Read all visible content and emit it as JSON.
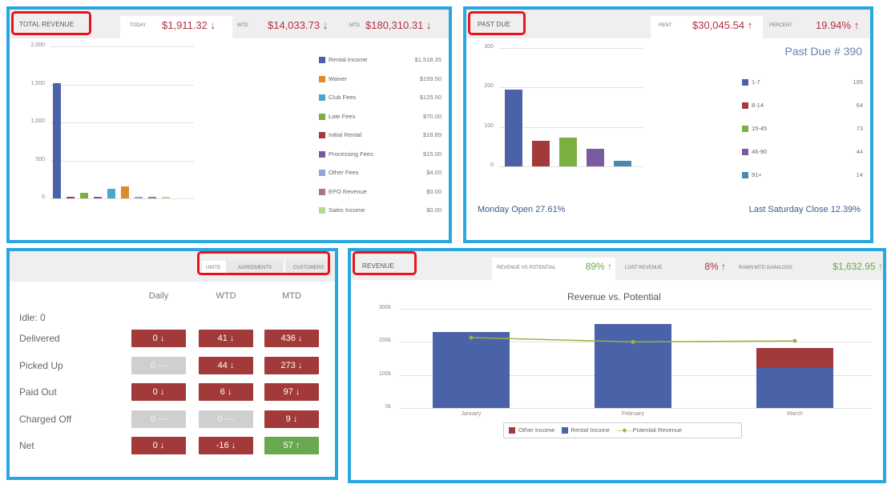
{
  "colors": {
    "panel_border": "#29a8e0",
    "highlight_box": "#e8141c",
    "negative": "#b03040",
    "positive": "#6aa84f",
    "series_rental": "#4a62a8",
    "series_other": "#a33a3a",
    "series_potential": "#9ab43c"
  },
  "total_revenue": {
    "title": "Total Revenue",
    "today_label": "Today",
    "today_value": "$1,911.32",
    "wtd_label": "WTD",
    "wtd_value": "$14,033.73",
    "mtd_label": "MTD",
    "mtd_value": "$180,310.31",
    "y_ticks": [
      "2,000",
      "1,500",
      "1,000",
      "500",
      "0"
    ],
    "legend": [
      {
        "name": "Rental Income",
        "value": "$1,518.35",
        "color": "#4a62a8"
      },
      {
        "name": "Waiver",
        "value": "$159.50",
        "color": "#e08a2c"
      },
      {
        "name": "Club Fees",
        "value": "$125.50",
        "color": "#4aa8c8"
      },
      {
        "name": "Late Fees",
        "value": "$70.00",
        "color": "#7ab040"
      },
      {
        "name": "Initial Rental",
        "value": "$18.89",
        "color": "#a33a3a"
      },
      {
        "name": "Processing Fees",
        "value": "$15.00",
        "color": "#7a5aa0"
      },
      {
        "name": "Other Fees",
        "value": "$4.00",
        "color": "#90a8d0"
      },
      {
        "name": "EPO Revenue",
        "value": "$0.00",
        "color": "#a87a7a"
      },
      {
        "name": "Sales Income",
        "value": "$0.00",
        "color": "#b8d890"
      }
    ],
    "chart_data": {
      "type": "bar",
      "ylim": [
        0,
        2000
      ],
      "values": [
        1518.35,
        18.89,
        70.0,
        15.0,
        125.5,
        159.5,
        4.0,
        4.0,
        0
      ],
      "colors": [
        "#4a62a8",
        "#a33a3a",
        "#7ab040",
        "#7a5aa0",
        "#4aa8c8",
        "#e08a2c",
        "#90a8d0",
        "#a87a7a",
        "#b8d890"
      ]
    }
  },
  "past_due": {
    "title": "Past Due",
    "rent_label": "Rent",
    "rent_value": "$30,045.54",
    "percent_label": "Percent",
    "percent_value": "19.94%",
    "count_title": "Past Due # 390",
    "y_ticks": [
      "300",
      "200",
      "100",
      "0"
    ],
    "legend": [
      {
        "name": "1-7",
        "value": "195",
        "color": "#4a62a8"
      },
      {
        "name": "8-14",
        "value": "64",
        "color": "#a33a3a"
      },
      {
        "name": "15-45",
        "value": "73",
        "color": "#7ab040"
      },
      {
        "name": "46-90",
        "value": "44",
        "color": "#7a5aa0"
      },
      {
        "name": "91+",
        "value": "14",
        "color": "#4a8ab0"
      }
    ],
    "chart_data": {
      "type": "bar",
      "categories": [
        "1-7",
        "8-14",
        "15-45",
        "46-90",
        "91+"
      ],
      "values": [
        195,
        64,
        73,
        44,
        14
      ],
      "ylim": [
        0,
        300
      ]
    },
    "footer_left": "Monday Open 27.61%",
    "footer_right": "Last Saturday Close 12.39%"
  },
  "units": {
    "tabs": [
      "Units",
      "Agreements",
      "Customers"
    ],
    "columns": [
      "Daily",
      "WTD",
      "MTD"
    ],
    "idle": "Idle: 0",
    "rows": [
      {
        "label": "Delivered",
        "cells": [
          {
            "v": "0",
            "dir": "down",
            "kind": "red"
          },
          {
            "v": "41",
            "dir": "down",
            "kind": "red"
          },
          {
            "v": "436",
            "dir": "down",
            "kind": "red"
          }
        ]
      },
      {
        "label": "Picked Up",
        "cells": [
          {
            "v": "0",
            "dir": "flat",
            "kind": "gray"
          },
          {
            "v": "44",
            "dir": "down",
            "kind": "red"
          },
          {
            "v": "273",
            "dir": "down",
            "kind": "red"
          }
        ]
      },
      {
        "label": "Paid Out",
        "cells": [
          {
            "v": "0",
            "dir": "down",
            "kind": "red"
          },
          {
            "v": "6",
            "dir": "down",
            "kind": "red"
          },
          {
            "v": "97",
            "dir": "down",
            "kind": "red"
          }
        ]
      },
      {
        "label": "Charged Off",
        "cells": [
          {
            "v": "0",
            "dir": "flat",
            "kind": "gray"
          },
          {
            "v": "0",
            "dir": "flat",
            "kind": "gray"
          },
          {
            "v": "9",
            "dir": "down",
            "kind": "red"
          }
        ]
      },
      {
        "label": "Net",
        "cells": [
          {
            "v": "0",
            "dir": "down",
            "kind": "red"
          },
          {
            "v": "-16",
            "dir": "down",
            "kind": "red"
          },
          {
            "v": "57",
            "dir": "up",
            "kind": "green"
          }
        ]
      }
    ]
  },
  "revenue": {
    "title": "Revenue",
    "tabs": [
      {
        "label": "Revenue vs Potential",
        "value": "89%",
        "dir": "up",
        "color": "#6aa84f"
      },
      {
        "label": "Lost Revenue",
        "value": "8%",
        "dir": "up",
        "color": "#b03040"
      },
      {
        "label": "Rawn MTD Gain/Loss",
        "value": "$1,632.95",
        "dir": "up",
        "color": "#6aa84f"
      }
    ],
    "chart_title": "Revenue vs. Potential",
    "y_ticks": [
      "300k",
      "200k",
      "100k",
      "0k"
    ],
    "legend": [
      "Other Income",
      "Rental Income",
      "Potential Revenue"
    ],
    "chart_data": {
      "type": "bar",
      "categories": [
        "January",
        "February",
        "March"
      ],
      "ylim": [
        0,
        300000
      ],
      "series": [
        {
          "name": "Rental Income",
          "values": [
            230000,
            255000,
            120000
          ]
        },
        {
          "name": "Other Income",
          "values": [
            0,
            0,
            62000
          ]
        },
        {
          "name": "Potential Revenue",
          "values": [
            213000,
            200000,
            203000
          ]
        }
      ]
    }
  }
}
